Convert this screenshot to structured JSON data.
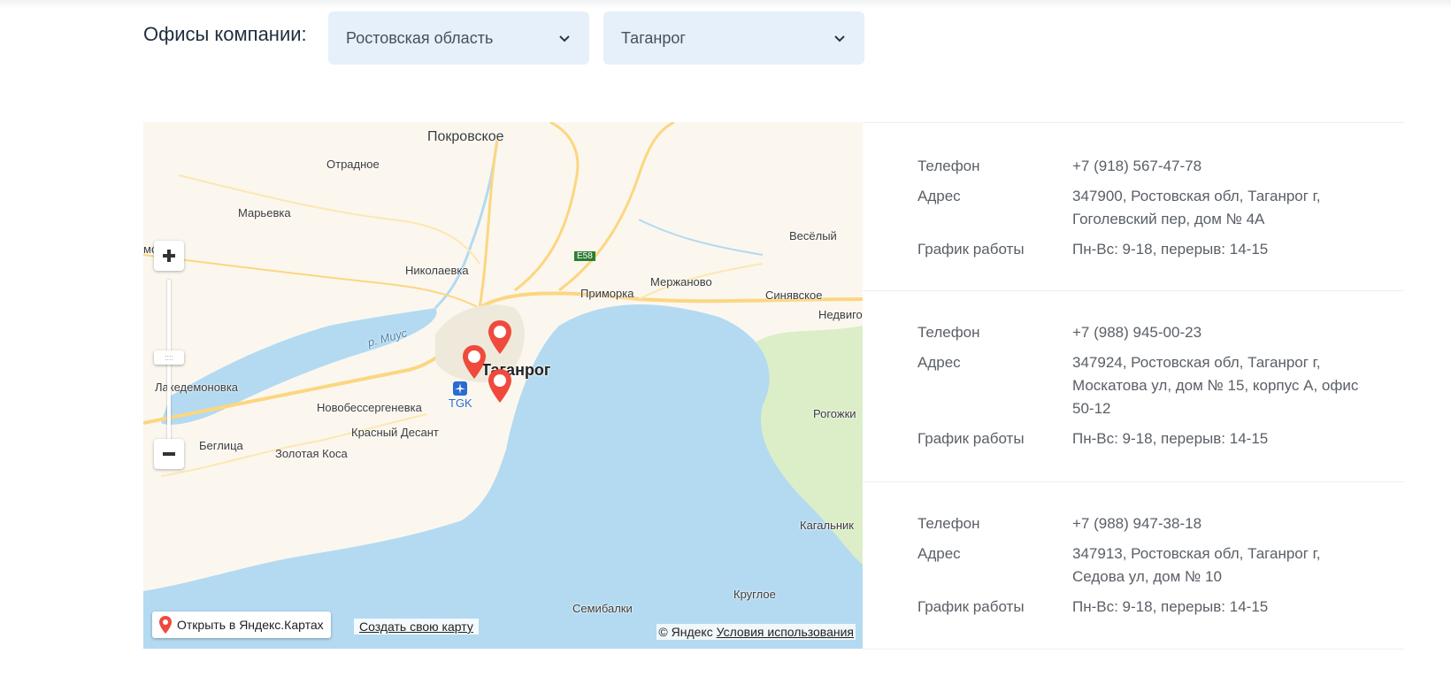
{
  "header": {
    "title": "Офисы компании:",
    "region_select": "Ростовская область",
    "city_select": "Таганрог"
  },
  "map": {
    "labels": {
      "pokrovskoe": "Покровское",
      "otradnoe": "Отрадное",
      "marevka": "Марьевка",
      "vesely": "Весёлый",
      "nikolaevka": "Николаевка",
      "e58": "E58",
      "primorka": "Приморка",
      "merzhanovo": "Мержаново",
      "sinyavskoe": "Синявское",
      "nedvigovka": "Недвиго",
      "r_mius": "р. Миус",
      "lakedemonovka": "Лакедемоновка",
      "taganrog": "Таганрог",
      "tgk": "TGK",
      "novobessergenevka": "Новобессергеневка",
      "krasny_desant": "Красный Десант",
      "beglitsa": "Беглица",
      "zolotaya_kosa": "Золотая Коса",
      "rogozhkino": "Рогожки",
      "kagalnik": "Кагальник",
      "krugloe": "Круглое",
      "semibalki": "Семибалки",
      "mo": "мо"
    },
    "open_button": "Открыть в Яндекс.Картах",
    "create_link": "Создать свою карту",
    "copyright": "© Яндекс",
    "terms": "Условия использования",
    "colors": {
      "water": "#b3daf1",
      "land": "#fbf7ef",
      "road": "#fcd680",
      "pin": "#ef4a3c",
      "marsh": "#dceec8"
    }
  },
  "offices": [
    {
      "phone_label": "Телефон",
      "phone": "+7 (918) 567-47-78",
      "address_label": "Адрес",
      "address": "347900, Ростовская обл, Таганрог г, Гоголевский пер, дом № 4А",
      "hours_label": "График работы",
      "hours": "Пн-Вс: 9-18, перерыв: 14-15"
    },
    {
      "phone_label": "Телефон",
      "phone": "+7 (988) 945-00-23",
      "address_label": "Адрес",
      "address": "347924, Ростовская обл, Таганрог г, Москатова ул, дом № 15, корпус А, офис 50-12",
      "hours_label": "График работы",
      "hours": "Пн-Вс: 9-18, перерыв: 14-15"
    },
    {
      "phone_label": "Телефон",
      "phone": "+7 (988) 947-38-18",
      "address_label": "Адрес",
      "address": "347913, Ростовская обл, Таганрог г, Седова ул, дом № 10",
      "hours_label": "График работы",
      "hours": "Пн-Вс: 9-18, перерыв: 14-15"
    }
  ]
}
